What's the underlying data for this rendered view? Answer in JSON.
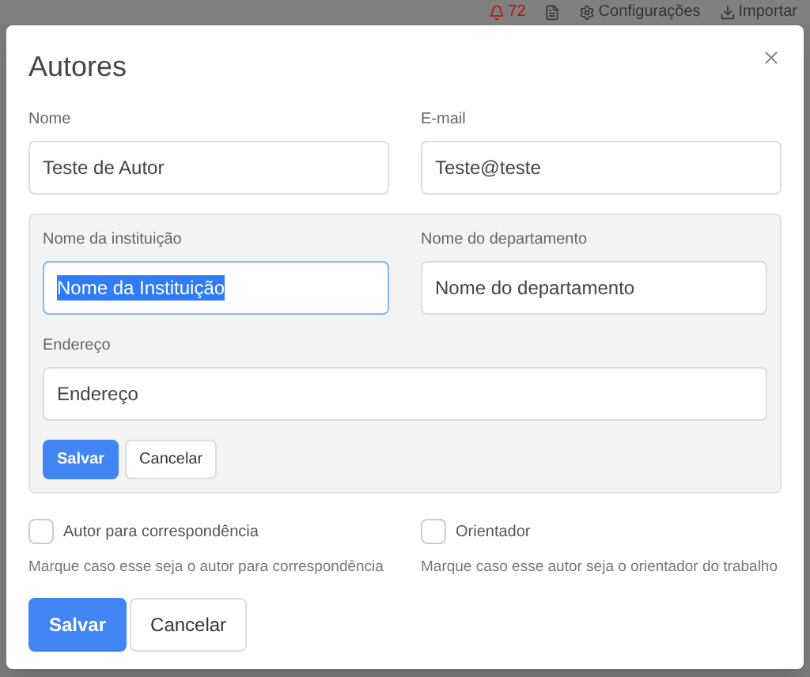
{
  "background_toolbar": {
    "notifications": "72",
    "settings": "Configurações",
    "import": "Importar"
  },
  "dialog": {
    "title": "Autores",
    "fields": [
      {
        "label": "Nome",
        "value": "Teste de Autor"
      },
      {
        "label": "E-mail",
        "value": "Teste@teste"
      }
    ],
    "institution_panel": {
      "fields": [
        {
          "label": "Nome da instituição",
          "value": "Nome da Instituição",
          "focused": true
        },
        {
          "label": "Nome do departamento",
          "value": "Nome do departamento",
          "focused": false
        },
        {
          "label": "Endereço",
          "value": "Endereço",
          "focused": false
        }
      ],
      "buttons": [
        {
          "label": "Salvar",
          "kind": "primary"
        },
        {
          "label": "Cancelar",
          "kind": "default"
        }
      ]
    },
    "checkboxes": [
      {
        "label": "Autor para correspondência",
        "help": "Marque caso esse seja o autor para correspondência",
        "checked": false
      },
      {
        "label": "Orientador",
        "help": "Marque caso esse autor seja o orientador do trabalho",
        "checked": false
      }
    ],
    "buttons": [
      {
        "label": "Salvar",
        "kind": "primary"
      },
      {
        "label": "Cancelar",
        "kind": "default"
      }
    ]
  }
}
